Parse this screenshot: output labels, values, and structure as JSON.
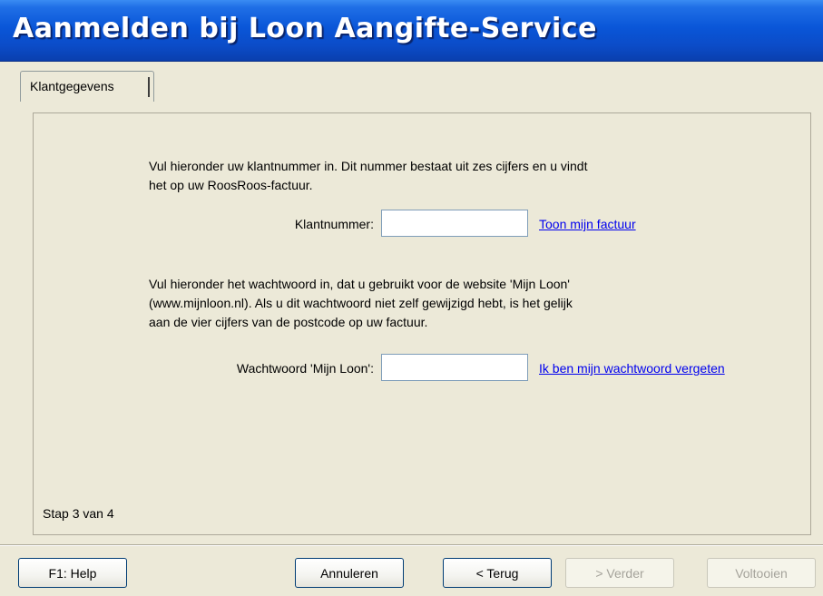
{
  "window": {
    "title": "Aanmelden bij Loon Aangifte-Service"
  },
  "tabs": [
    {
      "label": "Klantgegevens"
    }
  ],
  "form": {
    "intro_line1": "Vul hieronder uw klantnummer in. Dit nummer bestaat uit zes cijfers en u vindt",
    "intro_line2": "het op uw RoosRoos-factuur.",
    "customer_number_label": "Klantnummer:",
    "customer_number_value": "",
    "show_invoice_link": "Toon mijn factuur",
    "password_line1": "Vul hieronder het wachtwoord in, dat u gebruikt voor de website 'Mijn Loon'",
    "password_line2": "(www.mijnloon.nl). Als u dit wachtwoord niet zelf gewijzigd hebt, is het gelijk",
    "password_line3": "aan de vier cijfers van de postcode op uw factuur.",
    "password_label": "Wachtwoord 'Mijn Loon':",
    "password_value": "",
    "forgot_password_link": "Ik ben mijn wachtwoord vergeten"
  },
  "status": {
    "step_text": "Stap 3 van 4"
  },
  "buttons": {
    "help": "F1: Help",
    "cancel": "Annuleren",
    "back": "< Terug",
    "next": "> Verder",
    "finish": "Voltooien"
  }
}
